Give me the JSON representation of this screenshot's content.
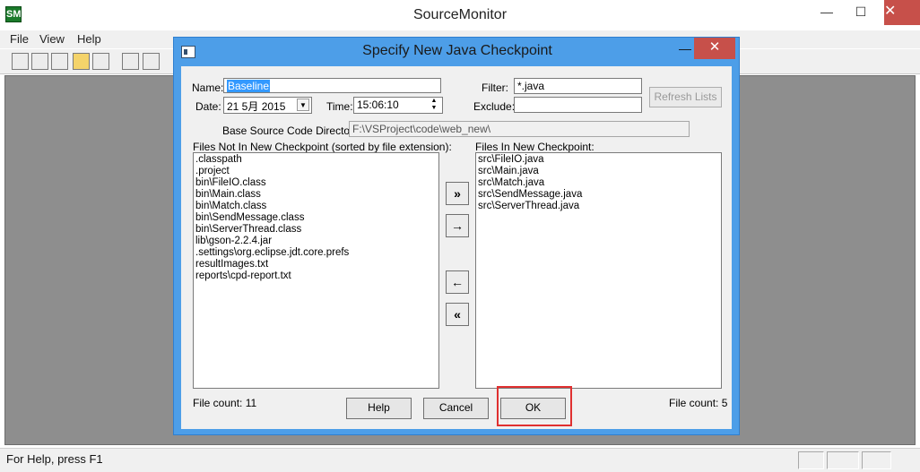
{
  "window": {
    "title": "SourceMonitor",
    "app_icon": "SM"
  },
  "menu": [
    "File",
    "View",
    "Help"
  ],
  "status": {
    "text": "For Help, press F1"
  },
  "dialog": {
    "title": "Specify New Java Checkpoint",
    "name_label": "Name:",
    "name_value": "Baseline",
    "date_label": "Date:",
    "date_value": "21 5月 2015",
    "time_label": "Time:",
    "time_value": "15:06:10",
    "filter_label": "Filter:",
    "filter_value": "*.java",
    "exclude_label": "Exclude:",
    "exclude_value": "",
    "refresh_label": "Refresh Lists",
    "base_dir_label": "Base Source Code Directory:",
    "base_dir_value": "F:\\VSProject\\code\\web_new\\",
    "left_list_label": "Files Not In New Checkpoint (sorted by file extension):",
    "right_list_label": "Files In New Checkpoint:",
    "left_files": [
      ".classpath",
      ".project",
      "bin\\FileIO.class",
      "bin\\Main.class",
      "bin\\Match.class",
      "bin\\SendMessage.class",
      "bin\\ServerThread.class",
      "lib\\gson-2.2.4.jar",
      ".settings\\org.eclipse.jdt.core.prefs",
      "resultImages.txt",
      "reports\\cpd-report.txt"
    ],
    "right_files": [
      "src\\FileIO.java",
      "src\\Main.java",
      "src\\Match.java",
      "src\\SendMessage.java",
      "src\\ServerThread.java"
    ],
    "left_count": "File count: 11",
    "right_count": "File count: 5",
    "help_label": "Help",
    "cancel_label": "Cancel",
    "ok_label": "OK",
    "arrows": {
      "move_all_right": "»",
      "move_right": "→",
      "move_left": "←",
      "move_all_left": "«"
    }
  },
  "colors": {
    "dialog_frame": "#4d9ee8",
    "close_button": "#c7504a",
    "highlight": "#e03030",
    "selection": "#3399ff",
    "mdi_background": "#8e8e8e"
  },
  "icons": [
    "app-icon",
    "minimize-icon",
    "maximize-icon",
    "close-icon",
    "new-file-icon",
    "open-folder-icon",
    "save-icon",
    "print-icon",
    "preview-icon",
    "spinner-up-icon",
    "spinner-down-icon",
    "dropdown-icon"
  ]
}
